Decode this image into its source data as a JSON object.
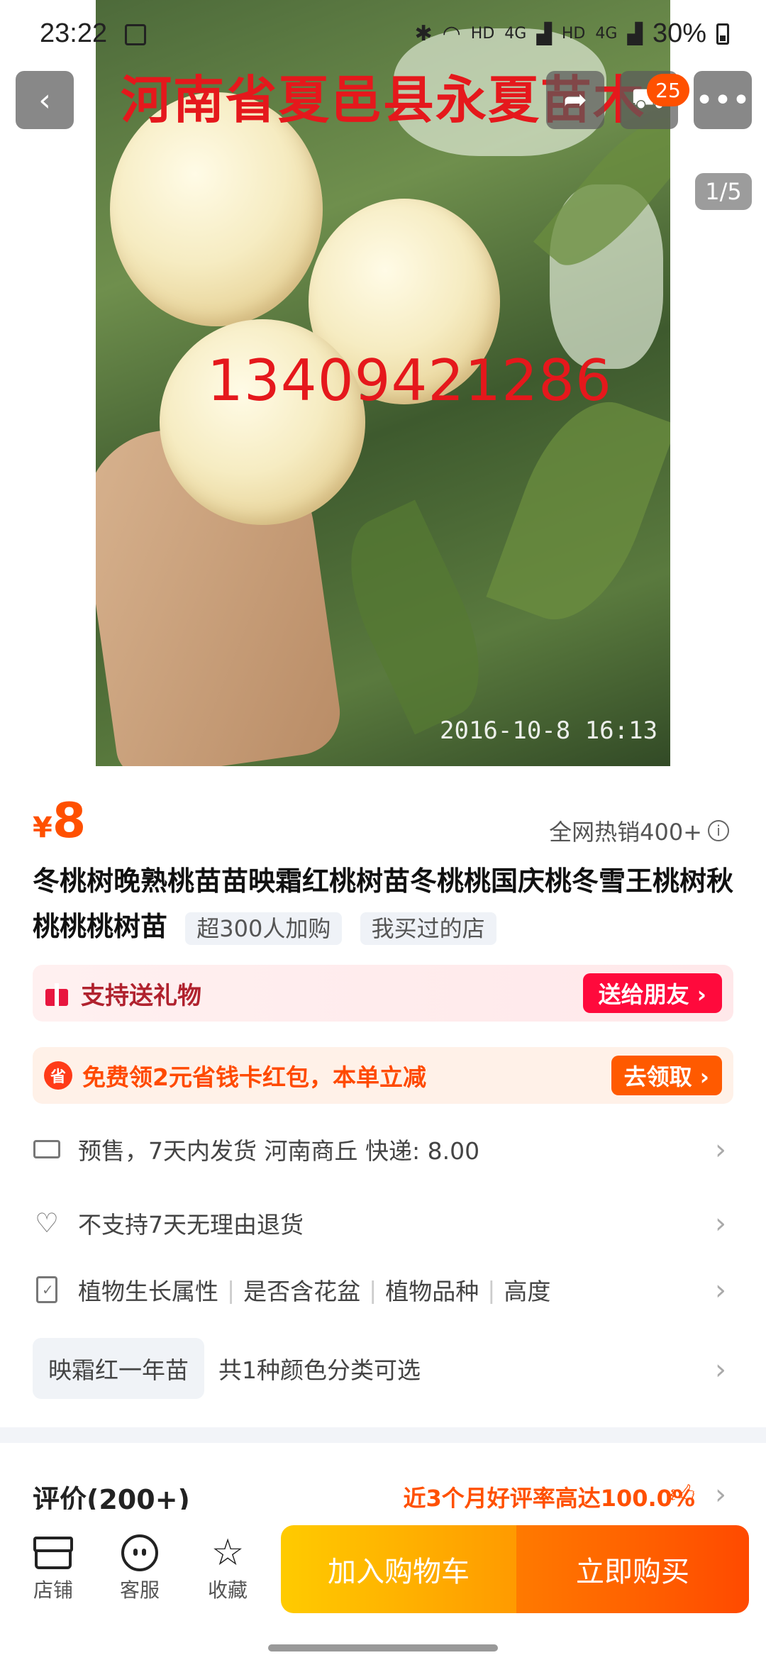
{
  "status_bar": {
    "time": "23:22",
    "network_labels": [
      "HD",
      "4G",
      "HD",
      "4G"
    ],
    "battery": "30%"
  },
  "gallery": {
    "watermark_title": "河南省夏邑县永夏苗木",
    "watermark_phone": "13409421286",
    "photo_timestamp": "2016-10-8  16:13",
    "page_indicator": "1/5"
  },
  "top_actions": {
    "cart_badge": "25"
  },
  "product": {
    "price_currency": "¥",
    "price_value": "8",
    "sales_text": "全网热销400+",
    "title": "冬桃树晚熟桃苗苗映霜红桃树苗冬桃桃国庆桃冬雪王桃树秋桃桃桃树苗",
    "tags": [
      "超300人加购",
      "我买过的店"
    ]
  },
  "gift": {
    "label": "支持送礼物",
    "cta": "送给朋友 ›"
  },
  "coupon": {
    "icon_text": "省",
    "label": "免费领2元省钱卡红包，本单立减",
    "cta": "去领取 ›"
  },
  "shipping": {
    "text": "预售，7天内发货  河南商丘  快递: 8.00"
  },
  "returns": {
    "text": "不支持7天无理由退货"
  },
  "attributes": {
    "items": [
      "植物生长属性",
      "是否含花盆",
      "植物品种",
      "高度"
    ]
  },
  "sku": {
    "chip": "映霜红一年苗",
    "text": "共1种颜色分类可选"
  },
  "review": {
    "label": "评价(200+)",
    "rate": "近3个月好评率高达100.0%"
  },
  "bottom_bar": {
    "shop": "店铺",
    "service": "客服",
    "favorite": "收藏",
    "add_to_cart": "加入购物车",
    "buy_now": "立即购买"
  },
  "colors": {
    "accent": "#ff5000",
    "gift_red": "#ff0a3c",
    "watermark_red": "#e5181c"
  }
}
